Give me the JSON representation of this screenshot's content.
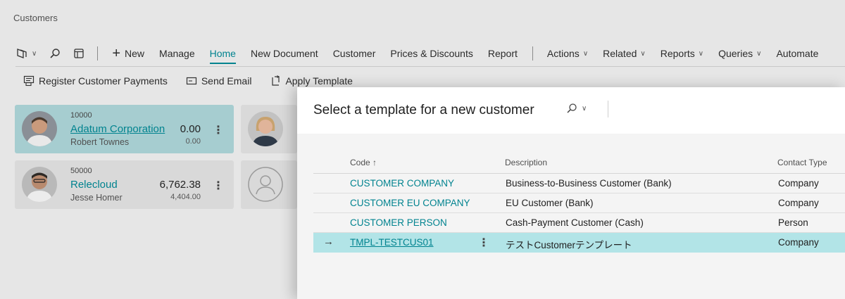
{
  "page": {
    "title": "Customers"
  },
  "commands": {
    "new_label": "New",
    "tabs": [
      "Manage",
      "Home",
      "New Document",
      "Customer",
      "Prices & Discounts",
      "Report"
    ],
    "menus": [
      "Actions",
      "Related",
      "Reports",
      "Queries",
      "Automate"
    ]
  },
  "actions": {
    "register_payments": "Register Customer Payments",
    "send_email": "Send Email",
    "apply_template": "Apply Template"
  },
  "tiles": [
    {
      "number": "10000",
      "name": "Adatum Corporation",
      "contact": "Robert Townes",
      "balance": "0.00",
      "balance_due": "0.00",
      "selected": true
    },
    {
      "number": "50000",
      "name": "Relecloud",
      "contact": "Jesse Homer",
      "balance": "6,762.38",
      "balance_due": "4,404.00",
      "selected": false
    }
  ],
  "dialog": {
    "title": "Select a template for a new customer",
    "columns": {
      "code": "Code ↑",
      "description": "Description",
      "contact_type": "Contact Type"
    },
    "rows": [
      {
        "code": "CUSTOMER COMPANY",
        "description": "Business-to-Business Customer (Bank)",
        "contact_type": "Company"
      },
      {
        "code": "CUSTOMER EU COMPANY",
        "description": "EU Customer (Bank)",
        "contact_type": "Company"
      },
      {
        "code": "CUSTOMER PERSON",
        "description": "Cash-Payment Customer (Cash)",
        "contact_type": "Person"
      },
      {
        "code": "TMPL-TESTCUS01",
        "description": "テストCustomerテンプレート",
        "contact_type": "Company"
      }
    ],
    "selected_row_marker": "→",
    "row_menu": "⋮"
  },
  "colors": {
    "accent": "#00838f",
    "selected_tile": "#a6cdd0",
    "selected_row": "#b2e4e7"
  }
}
